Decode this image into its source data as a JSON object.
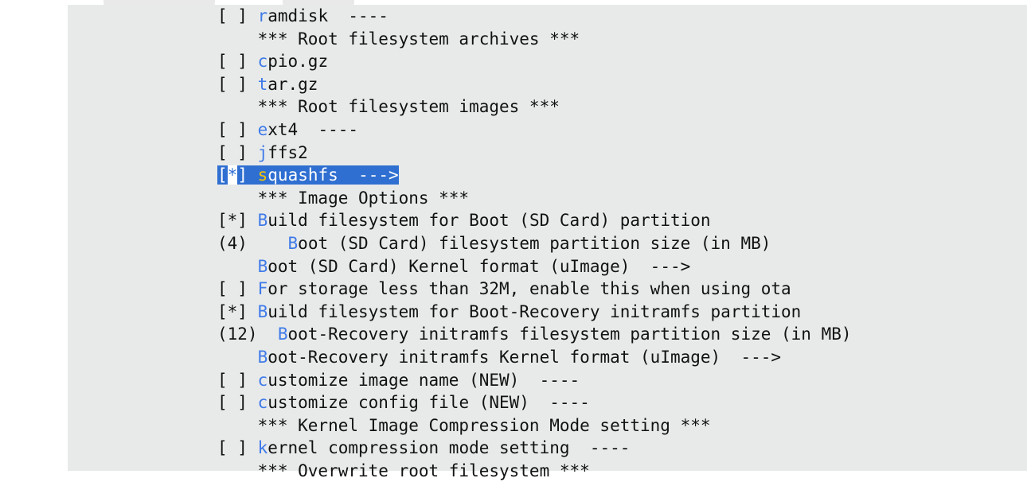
{
  "menu": {
    "items": [
      {
        "kind": "option",
        "prefix": "[ ] ",
        "hotkey": "r",
        "rest": "amdisk  ----",
        "selected": false
      },
      {
        "kind": "comment",
        "text": "    *** Root filesystem archives ***"
      },
      {
        "kind": "option",
        "prefix": "[ ] ",
        "hotkey": "c",
        "rest": "pio.gz",
        "selected": false
      },
      {
        "kind": "option",
        "prefix": "[ ] ",
        "hotkey": "t",
        "rest": "ar.gz",
        "selected": false
      },
      {
        "kind": "comment",
        "text": "    *** Root filesystem images ***"
      },
      {
        "kind": "option",
        "prefix": "[ ] ",
        "hotkey": "e",
        "rest": "xt4  ----",
        "selected": false
      },
      {
        "kind": "option",
        "prefix": "[ ] ",
        "hotkey": "j",
        "rest": "ffs2",
        "selected": false
      },
      {
        "kind": "option",
        "prefix": "[*] ",
        "hotkey": "s",
        "rest": "quashfs  --->",
        "selected": true
      },
      {
        "kind": "comment",
        "text": "    *** Image Options ***"
      },
      {
        "kind": "option",
        "prefix": "[*] ",
        "hotkey": "B",
        "rest": "uild filesystem for Boot (SD Card) partition",
        "selected": false
      },
      {
        "kind": "option",
        "prefix": "(4)    ",
        "hotkey": "B",
        "rest": "oot (SD Card) filesystem partition size (in MB)",
        "selected": false
      },
      {
        "kind": "option",
        "prefix": "    ",
        "hotkey": "B",
        "rest": "oot (SD Card) Kernel format (uImage)  --->",
        "selected": false
      },
      {
        "kind": "option",
        "prefix": "[ ] ",
        "hotkey": "F",
        "rest": "or storage less than 32M, enable this when using ota",
        "selected": false
      },
      {
        "kind": "option",
        "prefix": "[*] ",
        "hotkey": "B",
        "rest": "uild filesystem for Boot-Recovery initramfs partition",
        "selected": false
      },
      {
        "kind": "option",
        "prefix": "(12)  ",
        "hotkey": "B",
        "rest": "oot-Recovery initramfs filesystem partition size (in MB)",
        "selected": false
      },
      {
        "kind": "option",
        "prefix": "    ",
        "hotkey": "B",
        "rest": "oot-Recovery initramfs Kernel format (uImage)  --->",
        "selected": false
      },
      {
        "kind": "option",
        "prefix": "[ ] ",
        "hotkey": "c",
        "rest": "ustomize image name (NEW)  ----",
        "selected": false
      },
      {
        "kind": "option",
        "prefix": "[ ] ",
        "hotkey": "c",
        "rest": "ustomize config file (NEW)  ----",
        "selected": false
      },
      {
        "kind": "comment",
        "text": "    *** Kernel Image Compression Mode setting ***"
      },
      {
        "kind": "option",
        "prefix": "[ ] ",
        "hotkey": "k",
        "rest": "ernel compression mode setting  ----",
        "selected": false
      },
      {
        "kind": "comment",
        "text": "    *** Overwrite root filesystem ***"
      }
    ]
  }
}
